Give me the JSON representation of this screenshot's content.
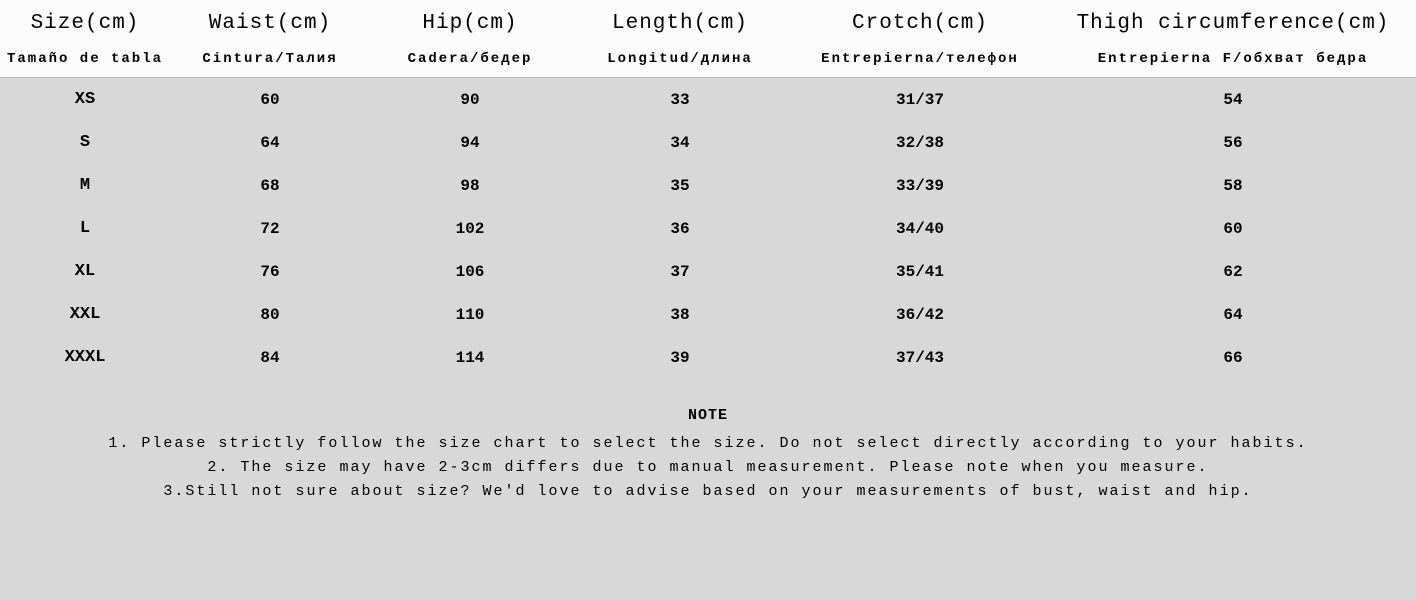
{
  "headers": {
    "size": "Size(cm)",
    "waist": "Waist(cm)",
    "hip": "Hip(cm)",
    "length": "Length(cm)",
    "crotch": "Crotch(cm)",
    "thigh": "Thigh circumference(cm)"
  },
  "subheaders": {
    "size": "Tamaño de tabla",
    "waist": "Cintura/Талия",
    "hip": "Cadera/бедер",
    "length": "Longitud/длина",
    "crotch": "Entrepierna/телефон",
    "thigh": "Entrepierna F/обхват бедра"
  },
  "rows": [
    {
      "size": "XS",
      "waist": "60",
      "hip": "90",
      "length": "33",
      "crotch": "31/37",
      "thigh": "54"
    },
    {
      "size": "S",
      "waist": "64",
      "hip": "94",
      "length": "34",
      "crotch": "32/38",
      "thigh": "56"
    },
    {
      "size": "M",
      "waist": "68",
      "hip": "98",
      "length": "35",
      "crotch": "33/39",
      "thigh": "58"
    },
    {
      "size": "L",
      "waist": "72",
      "hip": "102",
      "length": "36",
      "crotch": "34/40",
      "thigh": "60"
    },
    {
      "size": "XL",
      "waist": "76",
      "hip": "106",
      "length": "37",
      "crotch": "35/41",
      "thigh": "62"
    },
    {
      "size": "XXL",
      "waist": "80",
      "hip": "110",
      "length": "38",
      "crotch": "36/42",
      "thigh": "64"
    },
    {
      "size": "XXXL",
      "waist": "84",
      "hip": "114",
      "length": "39",
      "crotch": "37/43",
      "thigh": "66"
    }
  ],
  "notes": {
    "title": "NOTE",
    "line1": "1. Please strictly follow the size chart to select the size. Do not select directly according to your habits.",
    "line2": "2. The size may have 2-3cm differs due to manual measurement. Please note when you measure.",
    "line3": "3.Still not sure about size? We'd love to advise based on your measurements of bust, waist and hip."
  }
}
